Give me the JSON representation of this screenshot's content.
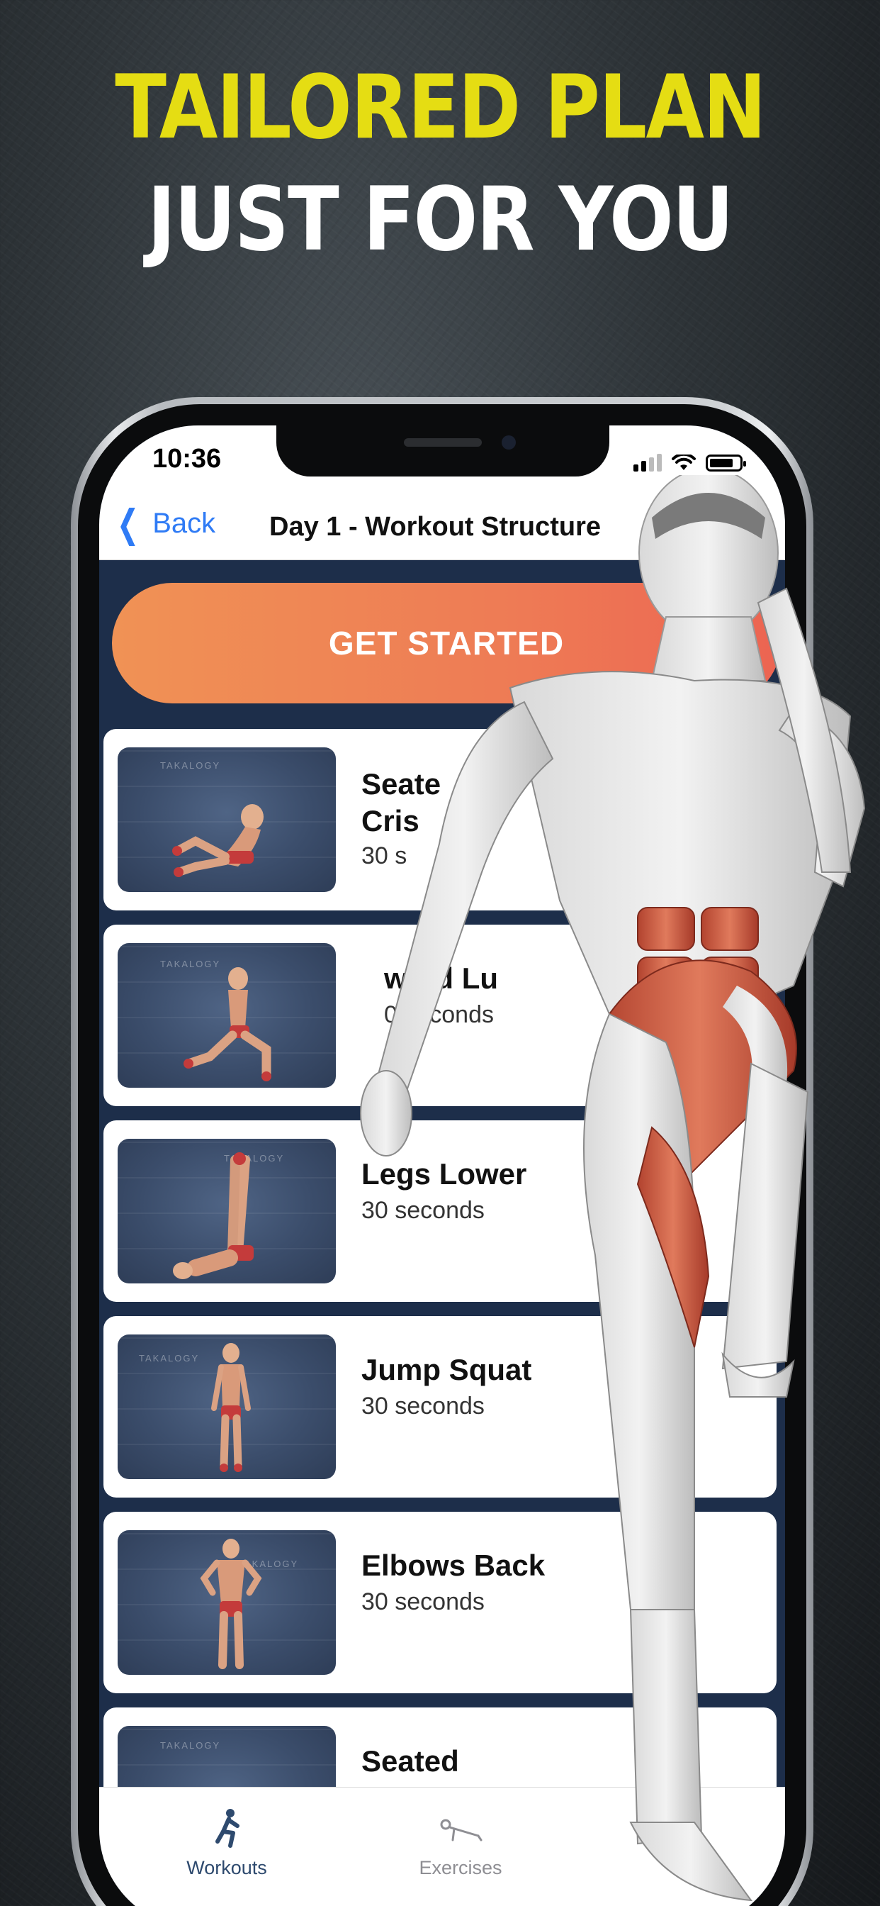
{
  "headline": {
    "line1": "TAILORED PLAN",
    "line2": "JUST FOR YOU"
  },
  "status_bar": {
    "time": "10:36"
  },
  "nav": {
    "back_label": "Back",
    "title": "Day 1 - Workout Structure"
  },
  "cta": {
    "label": "GET STARTED"
  },
  "exercises": [
    {
      "title": "Seated Crisscross",
      "visible_title": "Seate",
      "visible_title2": "Cris",
      "duration": "30 s"
    },
    {
      "title": "Forward Lunge",
      "visible_title": "ward Lu",
      "duration": "0 seconds"
    },
    {
      "title": "Legs Lower",
      "visible_title": "Legs Lower",
      "duration": "30 seconds"
    },
    {
      "title": "Jump Squat",
      "visible_title": "Jump Squat",
      "duration": "30 seconds"
    },
    {
      "title": "Elbows Back",
      "visible_title": "Elbows Back",
      "duration": "30 seconds"
    },
    {
      "title": "Seated",
      "visible_title": "Seated",
      "duration": ""
    }
  ],
  "thumb_watermark": "TAKALOGY",
  "tabs": [
    {
      "label": "Workouts",
      "icon": "workout-figure-icon",
      "active": true
    },
    {
      "label": "Exercises",
      "icon": "exercise-pushup-icon",
      "active": false
    }
  ],
  "colors": {
    "headline_yellow": "#e5dd13",
    "accent_blue": "#2f7bf5",
    "cta_start": "#f09255",
    "cta_end": "#ec6452",
    "list_bg": "#1d2e4a",
    "tab_active": "#2e4a6e",
    "tab_inactive": "#8e8e93"
  }
}
